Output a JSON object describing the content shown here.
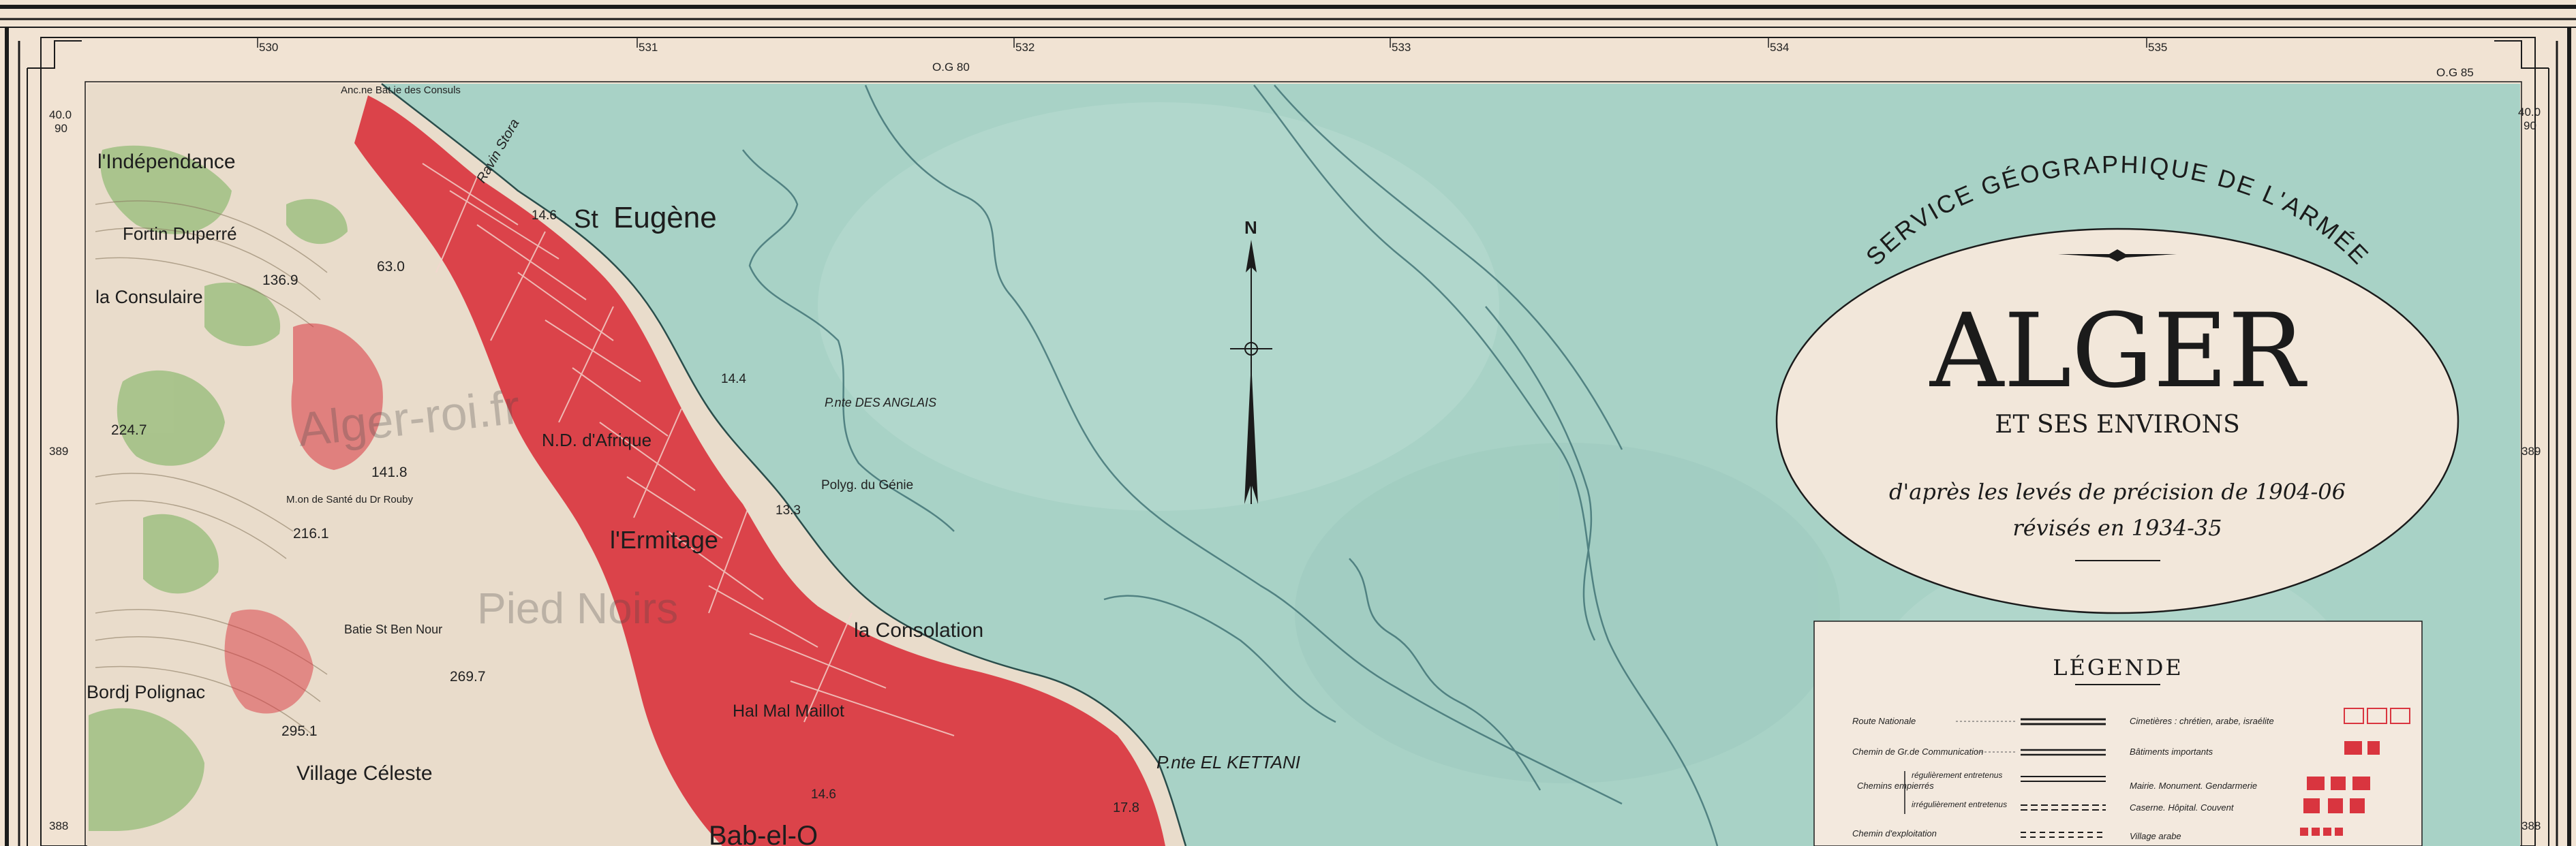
{
  "map": {
    "top_ticks": [
      "530",
      "531",
      "532",
      "533",
      "534",
      "535"
    ],
    "og_left": "O.G 80",
    "og_right": "O.G 85",
    "left_coords": [
      "40.0",
      "90",
      "389",
      "388"
    ],
    "right_coords": [
      "40.0",
      "90",
      "389",
      "388"
    ],
    "place_labels": {
      "independance": "l'Indépendance",
      "fortin": "Fortin Duperré",
      "consulaire": "la Consulaire",
      "st_eugene": "Eugène",
      "st_eugene_prefix": "St",
      "nd_afrique": "N.D. d'Afrique",
      "ermitage": "l'Ermitage",
      "consolation": "la Consolation",
      "bordj": "Bordj Polignac",
      "village_celeste": "Village Céleste",
      "maillot": "Hal Mal Maillot",
      "pointe_anglais": "P.nte DES ANGLAIS",
      "polyg": "Polyg. du Génie",
      "pointe_kettani": "P.nte EL KETTANI",
      "ravin": "Ravin Stora",
      "ancien_consuls": "Anc.ne Bat.ie des Consuls",
      "sainte_rouby": "M.on de Santé du Dr Rouby",
      "bat_ben_nour": "Batie St Ben Nour",
      "bab": "Bab-el-O"
    },
    "elevations": [
      "136.9",
      "63.0",
      "224.7",
      "141.8",
      "216.1",
      "269.7",
      "295.1",
      "14.6",
      "14.4",
      "13.3",
      "14.6",
      "17.8"
    ],
    "watermark_1": "Alger-roi.fr",
    "watermark_2": "Pied Noirs",
    "north_label": "N"
  },
  "title_block": {
    "service": "SERVICE GÉOGRAPHIQUE DE L'ARMÉE",
    "city": "ALGER",
    "subtitle": "ET SES ENVIRONS",
    "survey_line1": "d'après les levés de précision de 1904-06",
    "survey_line2": "révisés en 1934-35"
  },
  "legend": {
    "title": "LÉGENDE",
    "left_items": [
      "Route Nationale",
      "Chemin de Gr.de Communication",
      "Chemins empierrés",
      "Chemin d'exploitation"
    ],
    "empierres_sub": [
      "régulièrement entretenus",
      "irrégulièrement entretenus"
    ],
    "right_items": [
      "Cimetières : chrétien, arabe, israélite",
      "Bâtiments importants",
      "Mairie. Monument. Gendarmerie",
      "Caserne. Hôpital. Couvent",
      "Village arabe"
    ]
  },
  "colors": {
    "sea": "#a8d2c6",
    "paper": "#f1e3d3",
    "urban": "#d9353f",
    "land": "#e9dccb",
    "veg": "#9fbf82",
    "ink": "#1b1b1b"
  }
}
